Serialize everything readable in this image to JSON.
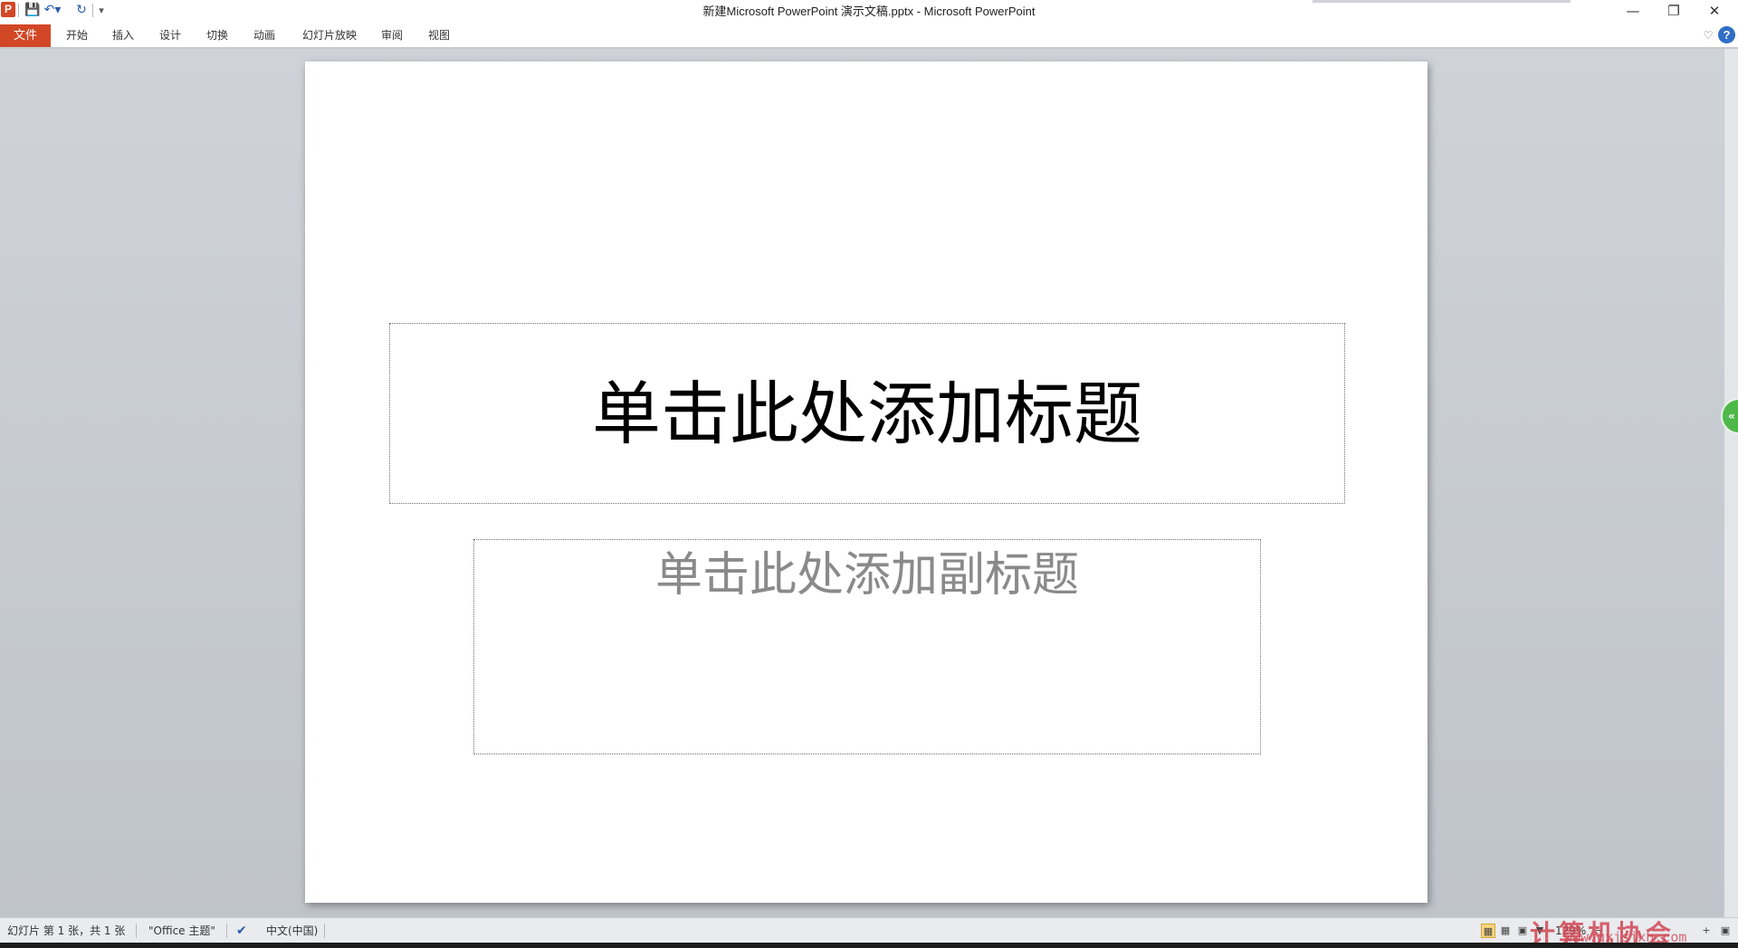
{
  "window": {
    "title": "新建Microsoft PowerPoint 演示文稿.pptx  -  Microsoft PowerPoint",
    "app_icon_letter": "P",
    "minimize": "—",
    "restore": "❐",
    "close": "✕"
  },
  "quick_access": {
    "save_icon": "save-icon",
    "undo_icon": "undo-icon",
    "redo_icon": "redo-icon",
    "customize_icon": "customize-icon"
  },
  "ribbon": {
    "file_tab": "文件",
    "tabs": [
      "开始",
      "插入",
      "设计",
      "切换",
      "动画",
      "幻灯片放映",
      "审阅",
      "视图"
    ],
    "help": "?"
  },
  "slide": {
    "title_placeholder": "单击此处添加标题",
    "subtitle_placeholder": "单击此处添加副标题"
  },
  "status_bar": {
    "slide_info": "幻灯片 第 1 张，共 1 张",
    "theme": "\"Office 主题\"",
    "language": "中文(中国)",
    "zoom": "129%"
  },
  "watermark": {
    "text": "计算机协会",
    "url": "www.gxjsjxh.com"
  },
  "colors": {
    "file_tab": "#d24726",
    "help": "#2f6fc5",
    "thumb_toggle": "#4fb84a"
  }
}
